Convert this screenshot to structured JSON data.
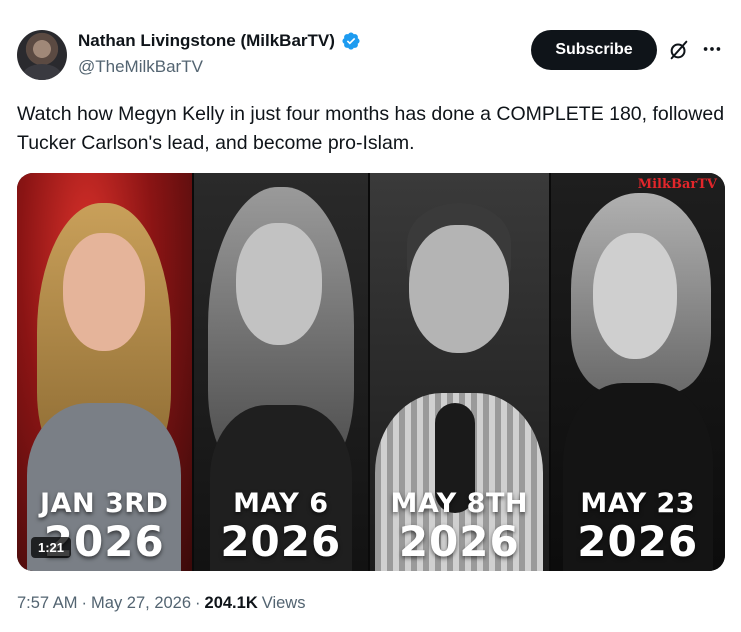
{
  "author": {
    "display_name": "Nathan Livingstone (MilkBarTV)",
    "handle": "@TheMilkBarTV",
    "verified_icon": "verified-badge-icon",
    "verified_color": "#1d9bf0"
  },
  "actions": {
    "subscribe_label": "Subscribe",
    "grok_icon": "grok-icon",
    "more_icon": "more-icon"
  },
  "tweet": {
    "text": "Watch how Megyn Kelly in just four months has done a COMPLETE 180, followed Tucker Carlson's lead, and become pro-Islam."
  },
  "video": {
    "duration": "1:21",
    "watermark": "MilkBarTV",
    "panels": [
      {
        "line1": "JAN 3RD",
        "line2": "2026"
      },
      {
        "line1": "MAY 6",
        "line2": "2026"
      },
      {
        "line1": "MAY 8TH",
        "line2": "2026"
      },
      {
        "line1": "MAY 23",
        "line2": "2026"
      }
    ]
  },
  "meta": {
    "time": "7:57 AM",
    "separator": "·",
    "date": "May 27, 2026",
    "views_count": "204.1K",
    "views_label": "Views"
  },
  "colors": {
    "text_primary": "#0f1419",
    "text_secondary": "#536471",
    "button_bg": "#0f1419",
    "watermark_red": "#e2262b"
  }
}
